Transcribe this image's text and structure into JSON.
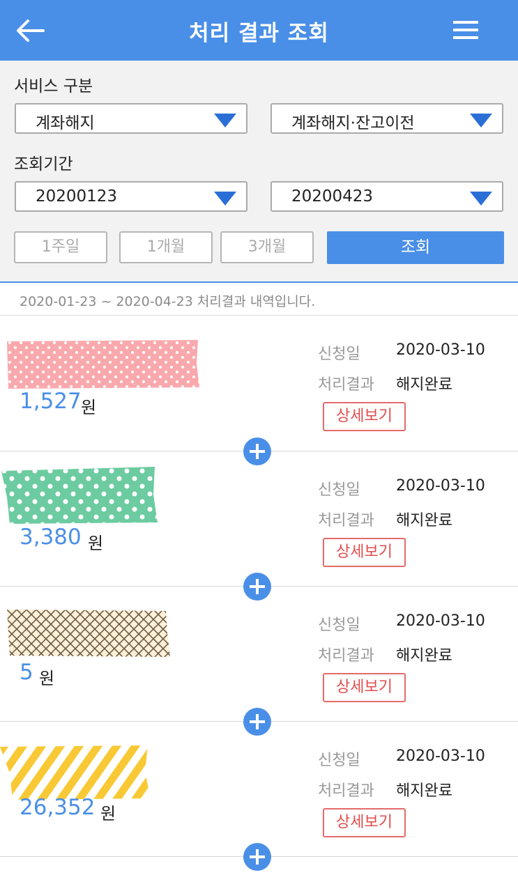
{
  "header": {
    "title": "처리 결과 조회"
  },
  "filter": {
    "service_label": "서비스 구분",
    "service_select_1": "계좌해지",
    "service_select_2": "계좌해지·잔고이전",
    "period_label": "조회기간",
    "date_from": "20200123",
    "date_to": "20200423",
    "period_buttons": [
      "1주일",
      "1개월",
      "3개월"
    ],
    "search_button": "조회"
  },
  "range_text": "2020-01-23 ~ 2020-04-23 처리결과 내역입니다.",
  "items": [
    {
      "amount": "1,527",
      "unit": "원",
      "apply_label": "신청일",
      "apply_date": "2020-03-10",
      "result_label": "처리결과",
      "result": "해지완료",
      "detail_button": "상세보기",
      "tape_pattern": "pink-dots"
    },
    {
      "amount": "3,380",
      "unit": "원",
      "apply_label": "신청일",
      "apply_date": "2020-03-10",
      "result_label": "처리결과",
      "result": "해지완료",
      "detail_button": "상세보기",
      "tape_pattern": "green-dots"
    },
    {
      "amount": "5",
      "unit": "원",
      "apply_label": "신청일",
      "apply_date": "2020-03-10",
      "result_label": "처리결과",
      "result": "해지완료",
      "detail_button": "상세보기",
      "tape_pattern": "cream-crosshatch"
    },
    {
      "amount": "26,352",
      "unit": "원",
      "apply_label": "신청일",
      "apply_date": "2020-03-10",
      "result_label": "처리결과",
      "result": "해지완료",
      "detail_button": "상세보기",
      "tape_pattern": "yellow-stripes"
    }
  ],
  "colors": {
    "primary": "#4a8fe7",
    "detail_red": "#e14c4c",
    "filter_bg": "#f2f2f2"
  }
}
